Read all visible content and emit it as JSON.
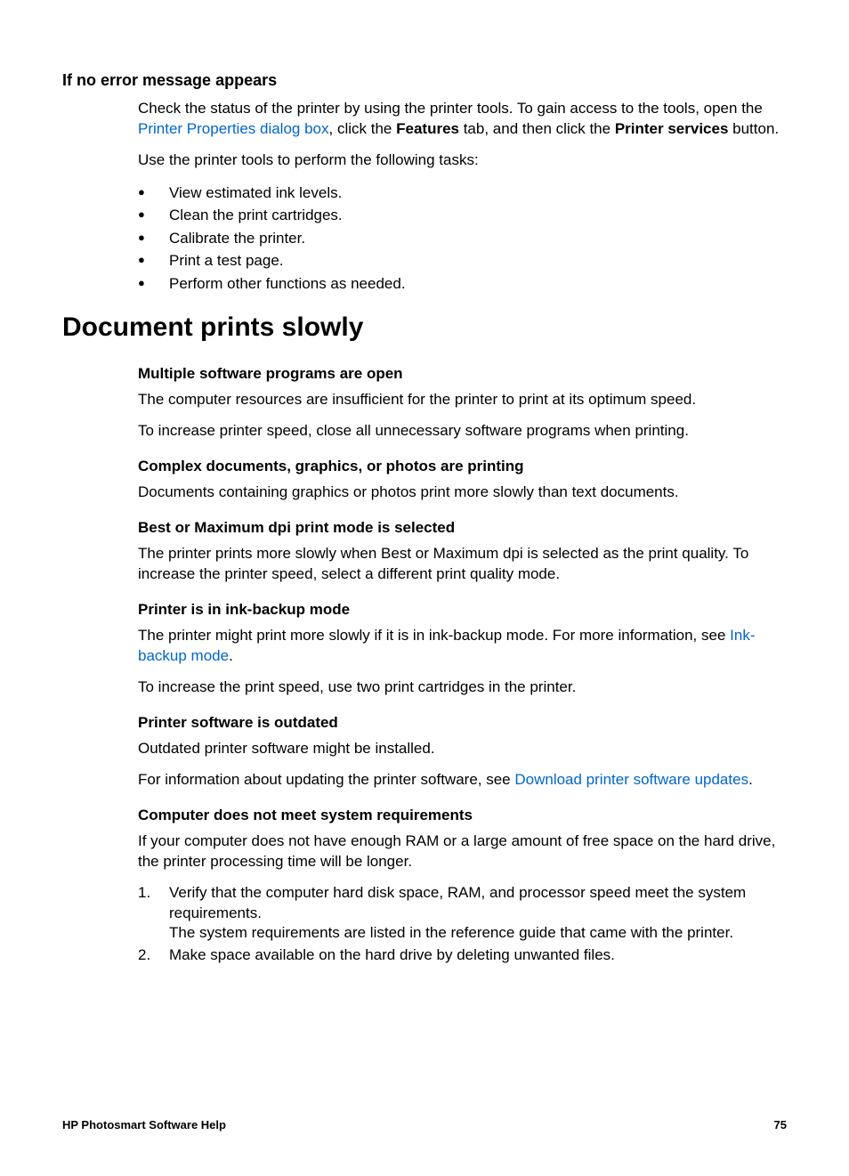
{
  "section1": {
    "heading": "If no error message appears",
    "p1_part1": "Check the status of the printer by using the printer tools. To gain access to the tools, open the ",
    "p1_link": "Printer Properties dialog box",
    "p1_part2": ", click the ",
    "p1_bold1": "Features",
    "p1_part3": " tab, and then click the ",
    "p1_bold2": "Printer services",
    "p1_part4": " button.",
    "p2": "Use the printer tools to perform the following tasks:",
    "bullets": [
      "View estimated ink levels.",
      "Clean the print cartridges.",
      "Calibrate the printer.",
      "Print a test page.",
      "Perform other functions as needed."
    ]
  },
  "section2": {
    "heading": "Document prints slowly",
    "sub1": {
      "heading": "Multiple software programs are open",
      "p1": "The computer resources are insufficient for the printer to print at its optimum speed.",
      "p2": "To increase printer speed, close all unnecessary software programs when printing."
    },
    "sub2": {
      "heading": "Complex documents, graphics, or photos are printing",
      "p1": "Documents containing graphics or photos print more slowly than text documents."
    },
    "sub3": {
      "heading": "Best or Maximum dpi print mode is selected",
      "p1": "The printer prints more slowly when Best or Maximum dpi is selected as the print quality. To increase the printer speed, select a different print quality mode."
    },
    "sub4": {
      "heading": "Printer is in ink-backup mode",
      "p1_part1": "The printer might print more slowly if it is in ink-backup mode. For more information, see ",
      "p1_link": "Ink-backup mode",
      "p1_part2": ".",
      "p2": "To increase the print speed, use two print cartridges in the printer."
    },
    "sub5": {
      "heading": "Printer software is outdated",
      "p1": "Outdated printer software might be installed.",
      "p2_part1": "For information about updating the printer software, see ",
      "p2_link": "Download printer software updates",
      "p2_part2": "."
    },
    "sub6": {
      "heading": "Computer does not meet system requirements",
      "p1": "If your computer does not have enough RAM or a large amount of free space on the hard drive, the printer processing time will be longer.",
      "step1": "Verify that the computer hard disk space, RAM, and processor speed meet the system requirements.",
      "step1b": "The system requirements are listed in the reference guide that came with the printer.",
      "step2": "Make space available on the hard drive by deleting unwanted files."
    }
  },
  "footer": {
    "left": "HP Photosmart Software Help",
    "right": "75"
  }
}
